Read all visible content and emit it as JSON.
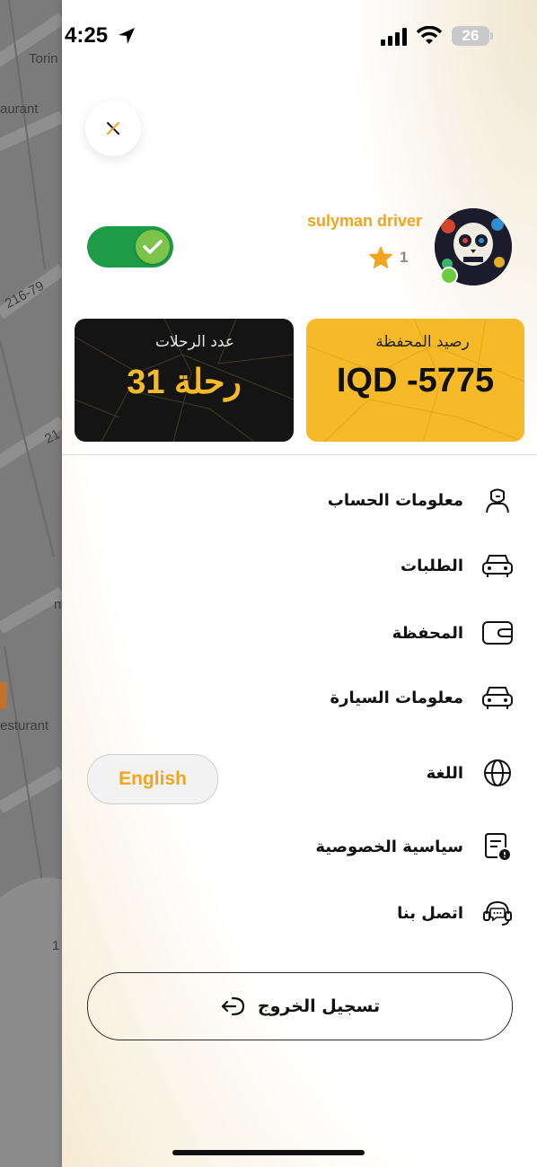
{
  "status_bar": {
    "time": "4:25",
    "battery": "26"
  },
  "map": {
    "labels": [
      "Torin",
      "aurant",
      "216-79",
      "21",
      "n",
      "esturant",
      "1"
    ]
  },
  "driver": {
    "name": "sulyman driver",
    "rating": "1",
    "online": true
  },
  "cards": {
    "wallet": {
      "label": "رصيد المحفظة",
      "value": "IQD -5775"
    },
    "trips": {
      "label": "عدد الرحلات",
      "value": "31 رحلة"
    }
  },
  "menu": {
    "account": "معلومات الحساب",
    "orders": "الطلبات",
    "wallet": "المحفظة",
    "car": "معلومات السيارة",
    "language": "اللغة",
    "privacy": "سياسية الخصوصية",
    "contact": "اتصل بنا"
  },
  "language_button": "English",
  "logout": "تسجيل الخروج",
  "colors": {
    "accent": "#f2a51c",
    "card_yellow": "#f6b928",
    "card_dark": "#141414",
    "toggle_green": "#1e9b47"
  }
}
